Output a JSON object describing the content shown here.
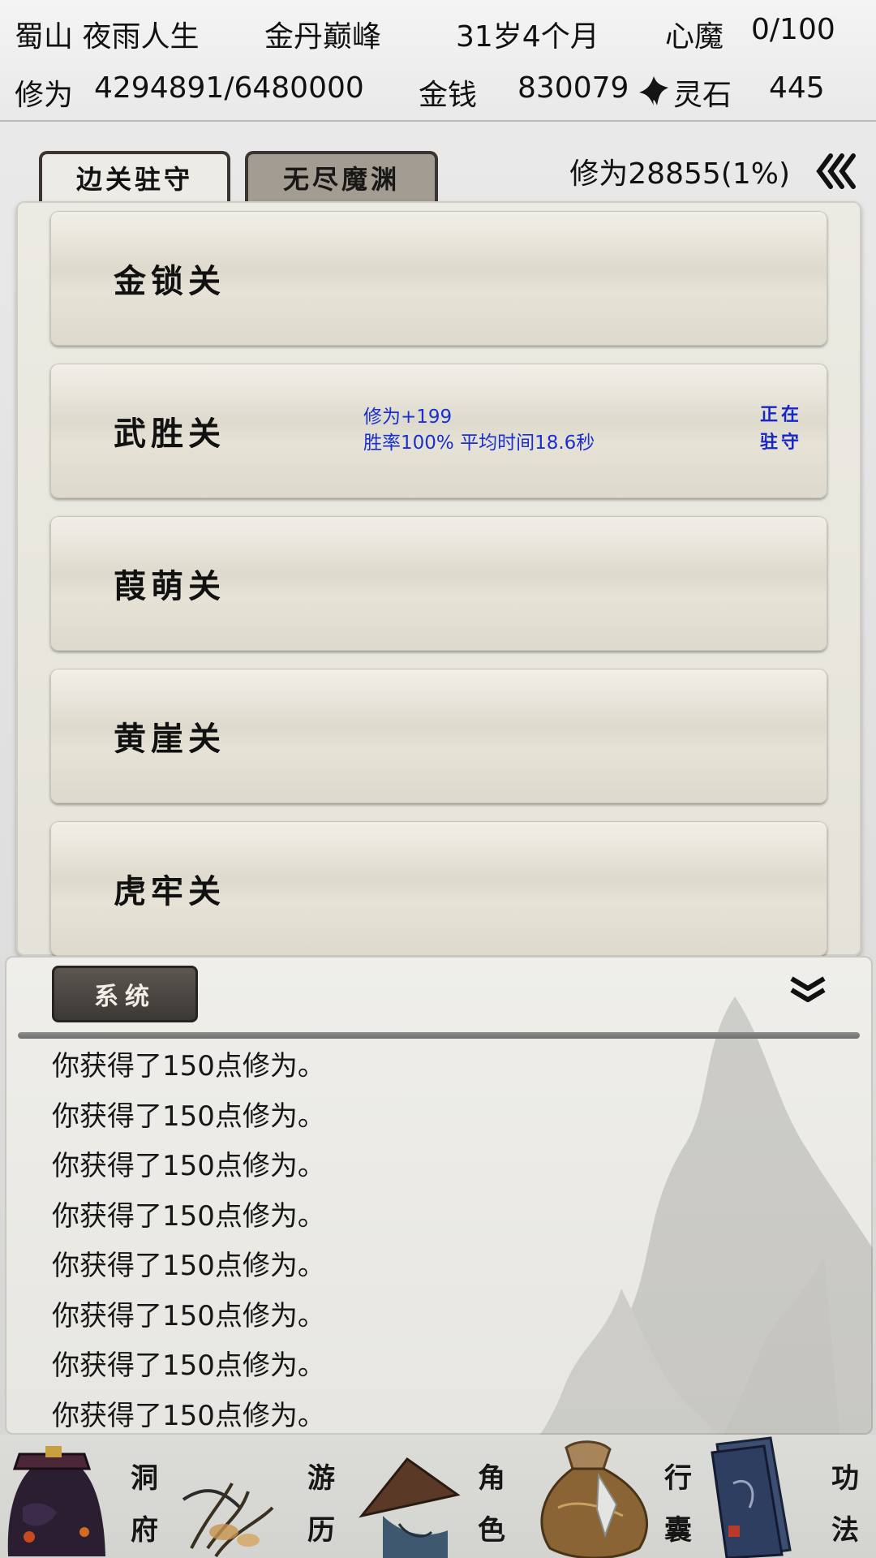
{
  "status": {
    "sect_name": "蜀山 夜雨人生",
    "realm": "金丹巅峰",
    "age": "31岁4个月",
    "heart_demon_label": "心魔",
    "heart_demon_value": "0/100",
    "cultivation_label": "修为",
    "cultivation_value": "4294891/6480000",
    "money_label": "金钱",
    "money_value": "830079",
    "spirit_stone_label": "灵石",
    "spirit_stone_value": "445"
  },
  "tabs": [
    {
      "label": "边关驻守",
      "active": true
    },
    {
      "label": "无尽魔渊",
      "active": false
    }
  ],
  "gain_info": "修为28855(1%)",
  "passes": [
    {
      "name": "金锁关"
    },
    {
      "name": "武胜关",
      "stats_line1": "修为+199",
      "stats_line2": "胜率100% 平均时间18.6秒",
      "guard_line1": "正在",
      "guard_line2": "驻守"
    },
    {
      "name": "葭萌关"
    },
    {
      "name": "黄崖关"
    },
    {
      "name": "虎牢关"
    }
  ],
  "log": {
    "tab_label": "系统",
    "lines": [
      "你获得了150点修为。",
      "你获得了150点修为。",
      "你获得了150点修为。",
      "你获得了150点修为。",
      "你获得了150点修为。",
      "你获得了150点修为。",
      "你获得了150点修为。",
      "你获得了150点修为。"
    ]
  },
  "nav": [
    {
      "label_top": "洞",
      "label_bottom": "府",
      "icon": "cave-residence-icon"
    },
    {
      "label_top": "游",
      "label_bottom": "历",
      "icon": "travel-hat-icon"
    },
    {
      "label_top": "角",
      "label_bottom": "色",
      "icon": "character-icon"
    },
    {
      "label_top": "行",
      "label_bottom": "囊",
      "icon": "bag-icon"
    },
    {
      "label_top": "功",
      "label_bottom": "法",
      "icon": "scripture-book-icon"
    }
  ]
}
